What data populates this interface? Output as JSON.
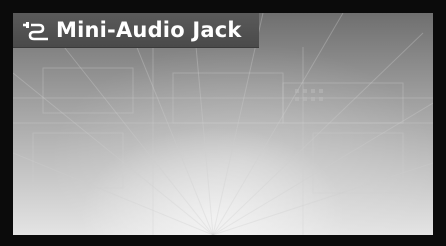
{
  "header": {
    "icon": "audio-jack-icon",
    "title": "Mini-Audio Jack"
  },
  "colors": {
    "frame": "#0b0b0b",
    "header_bg": "#4f4f4f",
    "header_text": "#ffffff"
  }
}
